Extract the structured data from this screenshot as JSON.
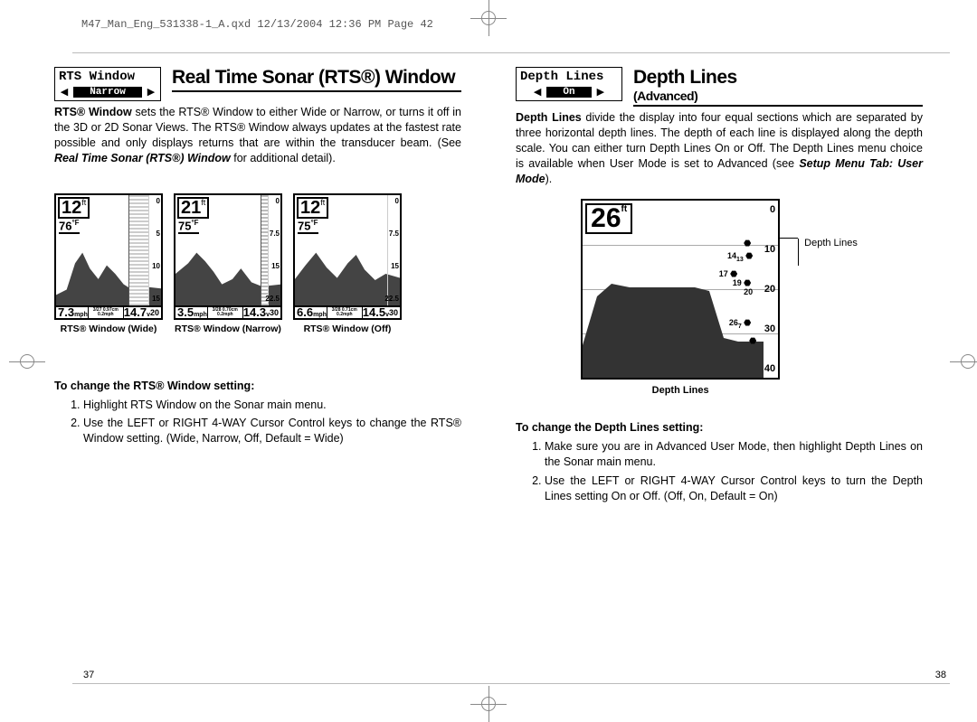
{
  "qxd_header": "M47_Man_Eng_531338-1_A.qxd  12/13/2004  12:36 PM  Page 42",
  "left": {
    "menu_title": "RTS Window",
    "menu_value": "Narrow",
    "section_title": "Real Time Sonar (RTS®) Window",
    "body": "RTS® Window sets the RTS® Window to either Wide or Narrow, or turns it off in the 3D or 2D Sonar Views. The RTS® Window always updates at the fastest rate possible and only displays returns that are within the transducer beam. (See Real Time Sonar (RTS®) Window for additional detail).",
    "body_bold_lead": "RTS® Window",
    "body_italic": "Real Time Sonar (RTS®) Window",
    "sonar": [
      {
        "depth": "12",
        "subdepth": "76",
        "spd1": "7.3",
        "spd2": "14.7",
        "tiny": "3/27\n0.97cm\n0.2mph",
        "caption": "RTS® Window (Wide)",
        "scale": [
          "0",
          "5",
          "10",
          "15",
          "20"
        ],
        "rts": "wide"
      },
      {
        "depth": "21",
        "subdepth": "75",
        "spd1": "3.5",
        "spd2": "14.3",
        "tiny": "3/28\n0.70cm\n0.2mph",
        "caption": "RTS® Window (Narrow)",
        "scale": [
          "0",
          "7.5",
          "15",
          "22.5",
          "30"
        ],
        "rts": "narrow"
      },
      {
        "depth": "12",
        "subdepth": "75",
        "spd1": "6.6",
        "spd2": "14.5",
        "tiny": "3/28\n0.71cm\n0.2mph",
        "caption": "RTS® Window (Off)",
        "scale": [
          "0",
          "7.5",
          "15",
          "22.5",
          "30"
        ],
        "rts": "off"
      }
    ],
    "instr_heading": "To change the RTS® Window setting:",
    "steps": [
      "Highlight RTS Window on the Sonar main menu.",
      "Use the LEFT or RIGHT 4-WAY Cursor Control keys to change the RTS® Window setting. (Wide, Narrow, Off, Default = Wide)"
    ],
    "page_num": "37"
  },
  "right": {
    "menu_title": "Depth Lines",
    "menu_value": "On",
    "section_title": "Depth Lines",
    "section_subtitle": "(Advanced)",
    "body": "Depth Lines divide the display into four equal sections which are separated by three horizontal depth lines. The depth of each line is displayed along the depth scale. You can either turn Depth Lines On or Off. The Depth Lines menu choice is available when User Mode is set to Advanced (see Setup Menu Tab: User Mode).",
    "body_bold_lead": "Depth Lines",
    "body_italic": "Setup Menu Tab: User Mode",
    "depth_fig": {
      "big": "26",
      "scale": [
        "0",
        "10",
        "20",
        "30",
        "40"
      ],
      "fish": [
        "14",
        "13",
        "17",
        "19",
        "20",
        "26",
        "7"
      ],
      "annot": "Depth\nLines",
      "caption": "Depth Lines"
    },
    "instr_heading": "To change the Depth Lines setting:",
    "steps": [
      "Make sure you are in Advanced User Mode, then highlight Depth Lines on the Sonar main menu.",
      "Use the LEFT or RIGHT 4-WAY Cursor Control keys to turn the Depth Lines setting On or Off. (Off, On, Default = On)"
    ],
    "page_num": "38"
  }
}
